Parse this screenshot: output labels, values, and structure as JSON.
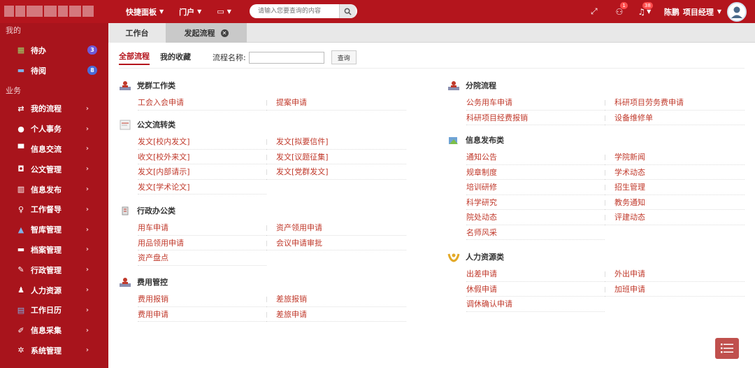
{
  "topnav": [
    {
      "label": "快捷面板"
    },
    {
      "label": "门户"
    },
    {
      "label": "▭"
    }
  ],
  "search": {
    "placeholder": "请输入您要查询的内容"
  },
  "tools": {
    "badge1": "1",
    "badge2": "38"
  },
  "user": {
    "name": "陈鹏",
    "role": "项目经理"
  },
  "sidebar": {
    "sec_mine": "我的",
    "sec_biz": "业务",
    "mine": [
      {
        "label": "待办",
        "count": "3",
        "icon": "grid-icon"
      },
      {
        "label": "待阅",
        "count": "8",
        "icon": "book-icon"
      }
    ],
    "biz": [
      {
        "label": "我的流程",
        "icon": "swap-icon"
      },
      {
        "label": "个人事务",
        "icon": "person-icon"
      },
      {
        "label": "信息交流",
        "icon": "chat-icon"
      },
      {
        "label": "公文管理",
        "icon": "briefcase-icon"
      },
      {
        "label": "信息发布",
        "icon": "book-open-icon"
      },
      {
        "label": "工作督导",
        "icon": "bulb-icon"
      },
      {
        "label": "智库管理",
        "icon": "graduation-icon"
      },
      {
        "label": "档案管理",
        "icon": "archive-icon"
      },
      {
        "label": "行政管理",
        "icon": "edit-icon"
      },
      {
        "label": "人力资源",
        "icon": "group-icon"
      },
      {
        "label": "工作日历",
        "icon": "calendar-icon"
      },
      {
        "label": "信息采集",
        "icon": "pencil-icon"
      },
      {
        "label": "系统管理",
        "icon": "gear-icon"
      }
    ]
  },
  "tabs": {
    "t1": "工作台",
    "t2": "发起流程"
  },
  "filter": {
    "all": "全部流程",
    "fav": "我的收藏",
    "label": "流程名称:",
    "button": "查询",
    "value": ""
  },
  "left": [
    {
      "title": "党群工作类",
      "links": [
        "工会入会申请",
        "提案申请"
      ]
    },
    {
      "title": "公文流转类",
      "links": [
        "发文[校内发文]",
        "发文[拟要信件]",
        "收文[校外来文]",
        "发文[议题征集]",
        "发文[内部请示]",
        "发文[党群发文]",
        "发文[学术论文]"
      ]
    },
    {
      "title": "行政办公类",
      "links": [
        "用车申请",
        "资产领用申请",
        "用品领用申请",
        "会议申请审批",
        "资产盘点"
      ]
    },
    {
      "title": "费用管控",
      "links": [
        "费用报销",
        "差旅报销",
        "费用申请",
        "差旅申请"
      ]
    }
  ],
  "right": [
    {
      "title": "分院流程",
      "links": [
        "公务用车申请",
        "科研项目劳务费申请",
        "科研项目经费报销",
        "设备维修单"
      ]
    },
    {
      "title": "信息发布类",
      "links": [
        "通知公告",
        "学院新闻",
        "规章制度",
        "学术动态",
        "培训研修",
        "招生管理",
        "科学研究",
        "教务通知",
        "院处动态",
        "评建动态",
        "名师风采"
      ]
    },
    {
      "title": "人力资源类",
      "links": [
        "出差申请",
        "外出申请",
        "休假申请",
        "加班申请",
        "调休确认申请"
      ]
    }
  ]
}
